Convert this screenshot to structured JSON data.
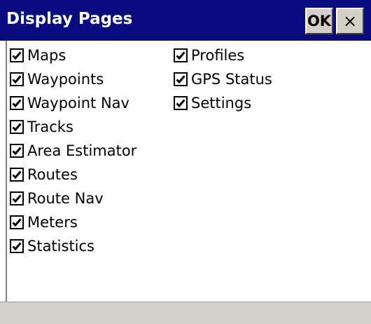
{
  "window": {
    "title": "Display Pages",
    "ok_label": "OK",
    "close_label": "×"
  },
  "checkbox_icon": "checkmark-icon",
  "colors": {
    "titlebar": "#0a0a80",
    "title_text": "#ffffff",
    "button_face": "#d4d0c8"
  },
  "pages": {
    "col1": [
      {
        "label": "Maps",
        "checked": true
      },
      {
        "label": "Waypoints",
        "checked": true
      },
      {
        "label": "Waypoint Nav",
        "checked": true
      },
      {
        "label": "Tracks",
        "checked": true
      },
      {
        "label": "Area Estimator",
        "checked": true
      },
      {
        "label": "Routes",
        "checked": true
      },
      {
        "label": "Route Nav",
        "checked": true
      },
      {
        "label": "Meters",
        "checked": true
      },
      {
        "label": "Statistics",
        "checked": true
      }
    ],
    "col2": [
      {
        "label": "Profiles",
        "checked": true
      },
      {
        "label": "GPS Status",
        "checked": true
      },
      {
        "label": "Settings",
        "checked": true
      }
    ]
  }
}
